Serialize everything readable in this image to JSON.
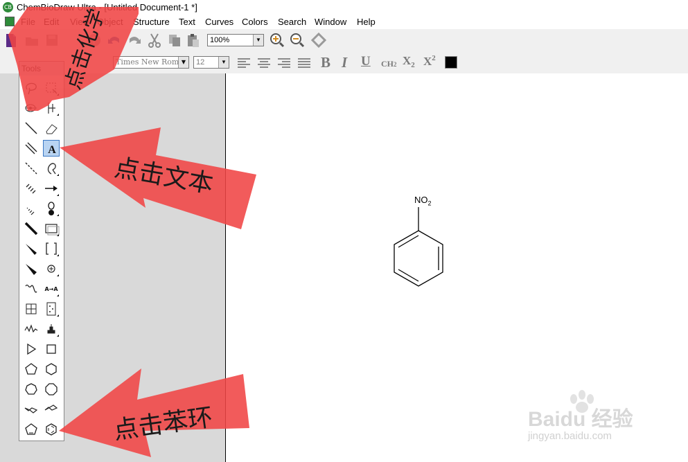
{
  "window": {
    "title": "ChemBioDraw Ultra - [Untitled Document-1 *]"
  },
  "menu": [
    "File",
    "Edit",
    "View",
    "Object",
    "Structure",
    "Text",
    "Curves",
    "Colors",
    "Search",
    "Window",
    "Help"
  ],
  "toolbar": {
    "zoom_value": "100%",
    "font_name": "Times New Roman",
    "font_size": "12",
    "bold": "B",
    "italic": "I",
    "underline": "U",
    "formula": "CH2",
    "subscript": "X2",
    "superscript": "X2",
    "text_color": "#000000"
  },
  "tools_palette": {
    "title": "Tools",
    "active_tool": "text-tool",
    "tools": [
      "lasso-tool",
      "marquee-tool",
      "structure-perspective-tool",
      "mass-fragmentation-tool",
      "solid-bond-tool",
      "eraser-tool",
      "multiple-bond-tool",
      "text-tool",
      "dashed-bond-tool",
      "pen-tool",
      "hashed-bond-tool",
      "arrow-tool",
      "hashed-wedge-bond-tool",
      "orbital-tool",
      "bold-bond-tool",
      "drawing-elements-tool",
      "wedge-bond-tool",
      "brackets-tool",
      "hollow-wedge-bond-tool",
      "chemical-symbols-tool",
      "wavy-bond-tool",
      "query-tool",
      "table-tool",
      "tlc-plate-tool",
      "spectrum-tool",
      "template-tool",
      "acyclic-chain-tool",
      "rectangle-tool",
      "cyclopentane-tool",
      "cyclohexane-tool",
      "cycloheptane-tool",
      "cyclooctane-tool",
      "cyclohexane-chair-1-tool",
      "cyclohexane-chair-2-tool",
      "cyclopentadiene-tool",
      "benzene-tool"
    ]
  },
  "canvas": {
    "molecule": {
      "substituent": "NO",
      "substituent_subscript": "2"
    }
  },
  "annotations": {
    "top": "点击化学",
    "middle": "点击文本",
    "bottom": "点击苯环",
    "color": "#f04444"
  },
  "watermark": {
    "brand": "Baidu 经验",
    "url": "jingyan.baidu.com"
  }
}
